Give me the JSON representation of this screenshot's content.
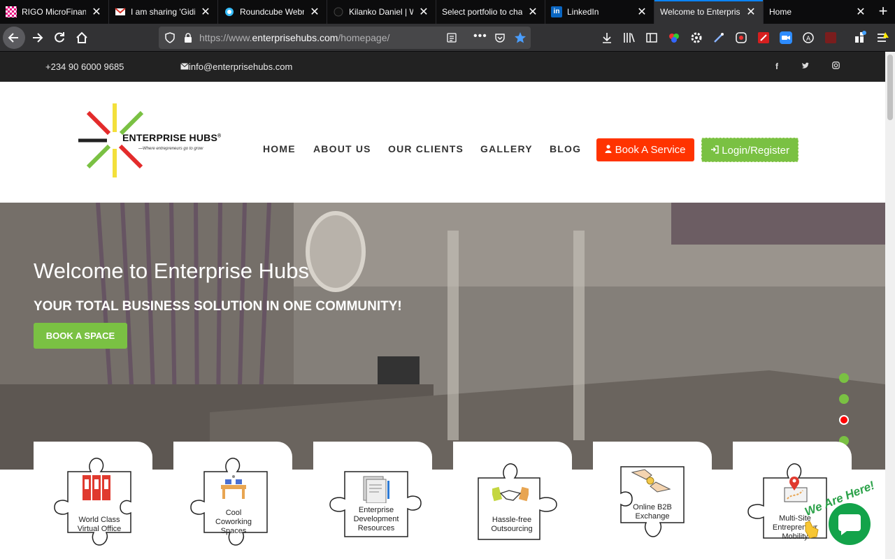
{
  "browser": {
    "tabs": [
      {
        "title": "RIGO MicroFinance",
        "favicon": "rigo-icon"
      },
      {
        "title": "I am sharing 'Gidi…",
        "favicon": "gmail-icon"
      },
      {
        "title": "Roundcube Webm…",
        "favicon": "roundcube-icon"
      },
      {
        "title": "Kilanko Daniel | W…",
        "favicon": "github-icon"
      },
      {
        "title": "Select portfolio to cha…",
        "favicon": "blank-icon"
      },
      {
        "title": "LinkedIn",
        "favicon": "linkedin-icon"
      },
      {
        "title": "Welcome to Enterprise…",
        "favicon": "none",
        "active": true
      },
      {
        "title": "Home",
        "favicon": "none"
      }
    ],
    "url_prefix": "https://www.",
    "url_domain": "enterprisehubs.com",
    "url_suffix": "/homepage/",
    "accent": "#0a84ff"
  },
  "topbar": {
    "phone": "+234 90 6000 9685",
    "email": "info@enterprisehubs.com",
    "social": [
      "facebook-icon",
      "twitter-icon",
      "instagram-icon"
    ]
  },
  "logo": {
    "name": "ENTERPRISE HUBS",
    "trademark": "®",
    "tagline": "—Where entrepreneurs go to grow"
  },
  "menu": {
    "home": "HOME",
    "about": "ABOUT US",
    "clients": "OUR CLIENTS",
    "gallery": "GALLERY",
    "blog": "BLOG",
    "book_service": "Book A Service",
    "login": "Login/Register"
  },
  "hero": {
    "title": "Welcome to Enterprise Hubs",
    "subtitle": "YOUR TOTAL BUSINESS SOLUTION IN ONE COMMUNITY!",
    "button": "BOOK A SPACE",
    "slides": 4,
    "active_slide": 3
  },
  "services": [
    {
      "label_lines": [
        "World Class",
        "Virtual Office"
      ],
      "icon": "binders-icon"
    },
    {
      "label_lines": [
        "Cool",
        "Coworking",
        "Spaces"
      ],
      "icon": "coworking-icon"
    },
    {
      "label_lines": [
        "Enterprise",
        "Development",
        "Resources"
      ],
      "icon": "documents-icon"
    },
    {
      "label_lines": [
        "Hassle-free",
        "Outsourcing"
      ],
      "icon": "handshake-icon"
    },
    {
      "label_lines": [
        "Online B2B",
        "Exchange"
      ],
      "icon": "exchange-icon"
    },
    {
      "label_lines": [
        "Multi-Site",
        "Entrepreneur",
        "Mobility"
      ],
      "icon": "map-pin-icon"
    }
  ],
  "chat": {
    "label": "We Are Here!"
  },
  "colors": {
    "green": "#7ac143",
    "red": "#ff3300",
    "dark": "#222222"
  }
}
